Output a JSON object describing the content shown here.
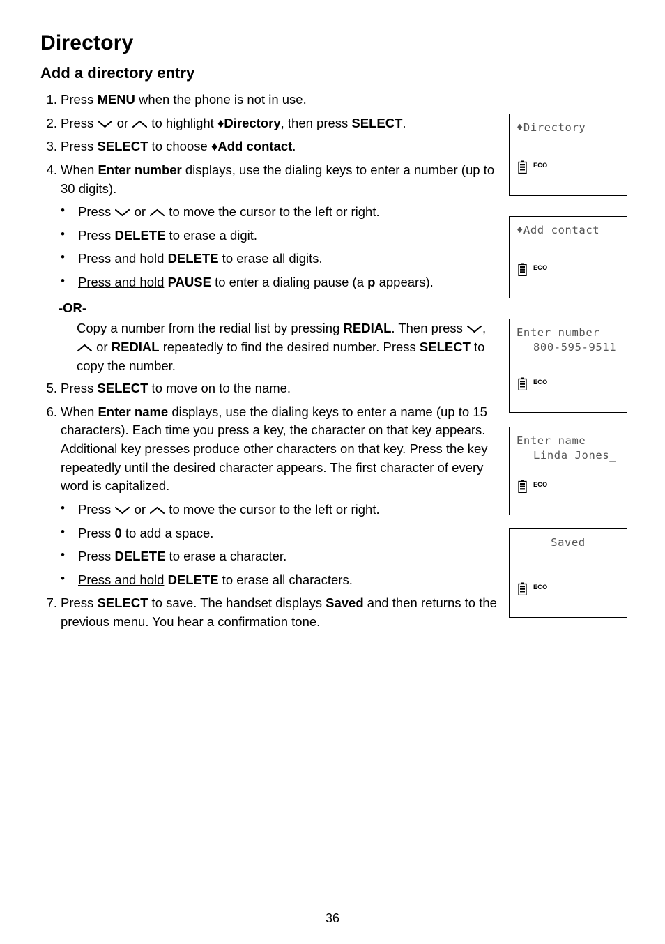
{
  "document": {
    "chapter_title": "Directory",
    "section_title": "Add a directory entry",
    "page_number": "36"
  },
  "steps": [
    {
      "num": "1.",
      "parts": [
        {
          "t": "Press "
        },
        {
          "t": "MENU",
          "b": true
        },
        {
          "t": " when the phone is not in use."
        }
      ]
    },
    {
      "num": "2.",
      "parts": [
        {
          "t": "Press "
        },
        {
          "icon": "volume-down-arrow-icon"
        },
        {
          "t": " or "
        },
        {
          "icon": "volume-up-arrow-icon"
        },
        {
          "t": " to highlight "
        },
        {
          "t": "♦Directory",
          "b": true
        },
        {
          "t": ", then press "
        },
        {
          "t": "SELECT",
          "b": true
        },
        {
          "t": "."
        }
      ]
    },
    {
      "num": "3.",
      "parts": [
        {
          "t": "Press "
        },
        {
          "t": "SELECT",
          "b": true
        },
        {
          "t": " to choose "
        },
        {
          "t": "♦Add contact",
          "b": true
        },
        {
          "t": "."
        }
      ]
    },
    {
      "num": "4.",
      "parts": [
        {
          "t": "When "
        },
        {
          "t": "Enter number",
          "b": true
        },
        {
          "t": " displays, use the dialing keys to enter a number (up to 30 digits)."
        }
      ],
      "subs": [
        {
          "parts": [
            {
              "t": "Press "
            },
            {
              "icon": "volume-down-arrow-icon"
            },
            {
              "t": " or "
            },
            {
              "icon": "volume-up-arrow-icon"
            },
            {
              "t": " to move the cursor to the left or right."
            }
          ]
        },
        {
          "parts": [
            {
              "t": "Press "
            },
            {
              "t": "DELETE",
              "b": true
            },
            {
              "t": " to erase a digit."
            }
          ]
        },
        {
          "parts": [
            {
              "t": "Press and hold",
              "u": true
            },
            {
              "t": " "
            },
            {
              "t": "DELETE",
              "b": true
            },
            {
              "t": " to erase all digits."
            }
          ]
        },
        {
          "parts": [
            {
              "t": "Press and hold",
              "u": true
            },
            {
              "t": " "
            },
            {
              "t": "PAUSE",
              "b": true
            },
            {
              "t": " to enter a dialing pause (a "
            },
            {
              "t": "p",
              "b": true
            },
            {
              "t": " appears)."
            }
          ]
        }
      ],
      "or_label": "-OR-",
      "or_parts": [
        {
          "t": "Copy a number from the redial list by pressing "
        },
        {
          "t": "REDIAL",
          "b": true
        },
        {
          "t": ". Then press "
        },
        {
          "icon": "volume-down-arrow-icon"
        },
        {
          "t": ", "
        },
        {
          "icon": "volume-up-arrow-icon"
        },
        {
          "t": " or "
        },
        {
          "t": "REDIAL",
          "b": true
        },
        {
          "t": " repeatedly to find the desired number. Press "
        },
        {
          "t": "SELECT",
          "b": true
        },
        {
          "t": " to copy the number."
        }
      ]
    },
    {
      "num": "5.",
      "parts": [
        {
          "t": "Press "
        },
        {
          "t": "SELECT",
          "b": true
        },
        {
          "t": " to move on to the name."
        }
      ]
    },
    {
      "num": "6.",
      "parts": [
        {
          "t": "When "
        },
        {
          "t": "Enter name",
          "b": true
        },
        {
          "t": " displays, use the dialing keys to enter a name (up to 15 characters). Each time you press a key, the character on that key appears. Additional key presses produce other characters on that key. Press the key repeatedly until the desired character appears. The first character of every word is capitalized."
        }
      ],
      "subs": [
        {
          "parts": [
            {
              "t": "Press "
            },
            {
              "icon": "volume-down-arrow-icon"
            },
            {
              "t": " or "
            },
            {
              "icon": "volume-up-arrow-icon"
            },
            {
              "t": " to move the cursor to the left or right."
            }
          ]
        },
        {
          "parts": [
            {
              "t": "Press "
            },
            {
              "t": "0",
              "b": true
            },
            {
              "t": " to add a space."
            }
          ]
        },
        {
          "parts": [
            {
              "t": "Press "
            },
            {
              "t": "DELETE",
              "b": true
            },
            {
              "t": " to erase a character."
            }
          ]
        },
        {
          "parts": [
            {
              "t": "Press and hold",
              "u": true
            },
            {
              "t": " "
            },
            {
              "t": "DELETE",
              "b": true
            },
            {
              "t": " to erase all characters."
            }
          ]
        }
      ]
    },
    {
      "num": "7.",
      "parts": [
        {
          "t": "Press "
        },
        {
          "t": "SELECT",
          "b": true
        },
        {
          "t": " to save. The handset displays "
        },
        {
          "t": "Saved",
          "b": true
        },
        {
          "t": " and then returns to the previous menu. You hear a confirmation tone."
        }
      ]
    }
  ],
  "screens": [
    {
      "name": "screen-directory",
      "line1": "♦Directory",
      "line2": "",
      "center": false,
      "eco_label": "ECO"
    },
    {
      "name": "screen-add-contact",
      "line1": "♦Add contact",
      "line2": "",
      "center": false,
      "eco_label": "ECO"
    },
    {
      "name": "screen-enter-number",
      "line1": "Enter number",
      "line2": "800-595-9511_",
      "center": false,
      "eco_label": "ECO"
    },
    {
      "name": "screen-enter-name",
      "line1": "Enter name",
      "line2": "Linda Jones_",
      "center": false,
      "eco_label": "ECO"
    },
    {
      "name": "screen-saved",
      "line1": "Saved",
      "line2": "",
      "center": true,
      "eco_label": "ECO"
    }
  ]
}
